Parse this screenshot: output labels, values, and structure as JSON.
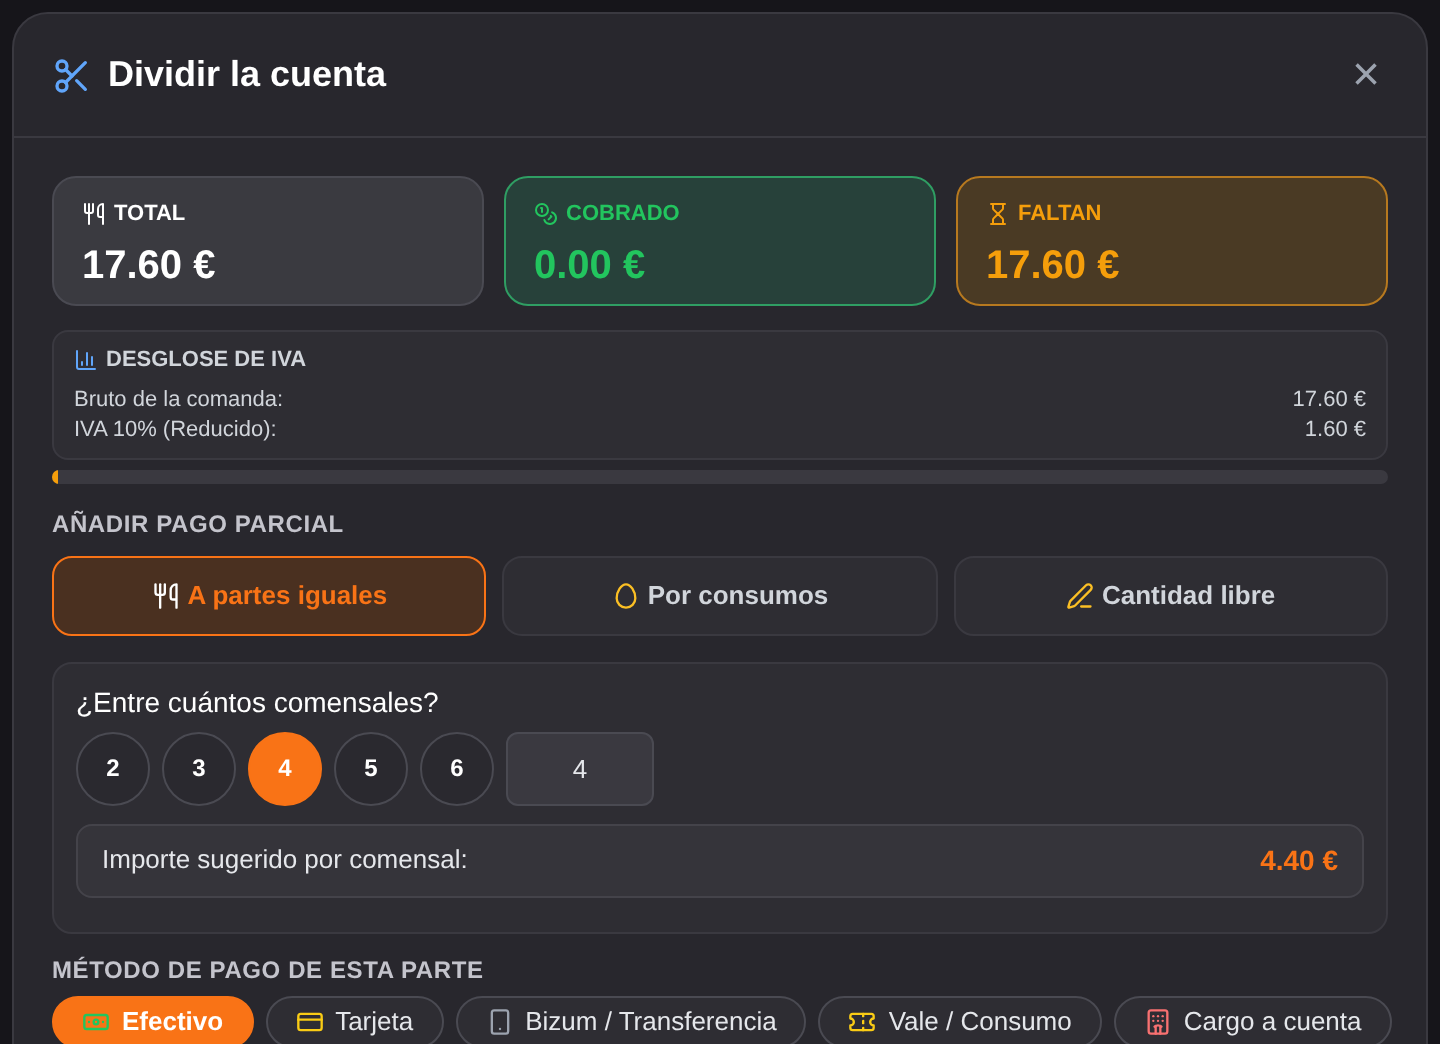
{
  "modal": {
    "title": "Dividir la cuenta",
    "close": "×"
  },
  "stats": [
    {
      "kind": "total",
      "label": "TOTAL",
      "value": "17.60 €"
    },
    {
      "kind": "paid",
      "label": "COBRADO",
      "value": "0.00 €"
    },
    {
      "kind": "pending",
      "label": "FALTAN",
      "value": "17.60 €"
    }
  ],
  "vat": {
    "title": "DESGLOSE DE IVA",
    "rows": [
      {
        "label": "Bruto de la comanda:",
        "value": "17.60 €"
      },
      {
        "label": "IVA 10% (Reducido):",
        "value": "1.60 €"
      }
    ]
  },
  "progress": {
    "level": 0.004
  },
  "partial": {
    "title": "AÑADIR PAGO PARCIAL",
    "modes": [
      {
        "kind": "equal",
        "label": "A partes iguales",
        "selected": true
      },
      {
        "kind": "items",
        "label": "Por consumos",
        "selected": false
      },
      {
        "kind": "free",
        "label": "Cantidad libre",
        "selected": false
      }
    ]
  },
  "diners": {
    "question": "¿Entre cuántos comensales?",
    "options": [
      {
        "label": "2",
        "selected": false
      },
      {
        "label": "3",
        "selected": false
      },
      {
        "label": "4",
        "selected": true
      },
      {
        "label": "5",
        "selected": false
      },
      {
        "label": "6",
        "selected": false
      }
    ],
    "custom_value": "4",
    "suggested_label": "Importe sugerido por comensal:",
    "suggested_value": "4.40 €"
  },
  "method": {
    "title": "MÉTODO DE PAGO DE ESTA PARTE",
    "options": [
      {
        "kind": "cash",
        "label": "Efectivo",
        "selected": true
      },
      {
        "kind": "card",
        "label": "Tarjeta",
        "selected": false
      },
      {
        "kind": "phone",
        "label": "Bizum / Transferencia",
        "selected": false
      },
      {
        "kind": "voucher",
        "label": "Vale / Consumo",
        "selected": false
      },
      {
        "kind": "account",
        "label": "Cargo a cuenta",
        "selected": false
      }
    ]
  }
}
